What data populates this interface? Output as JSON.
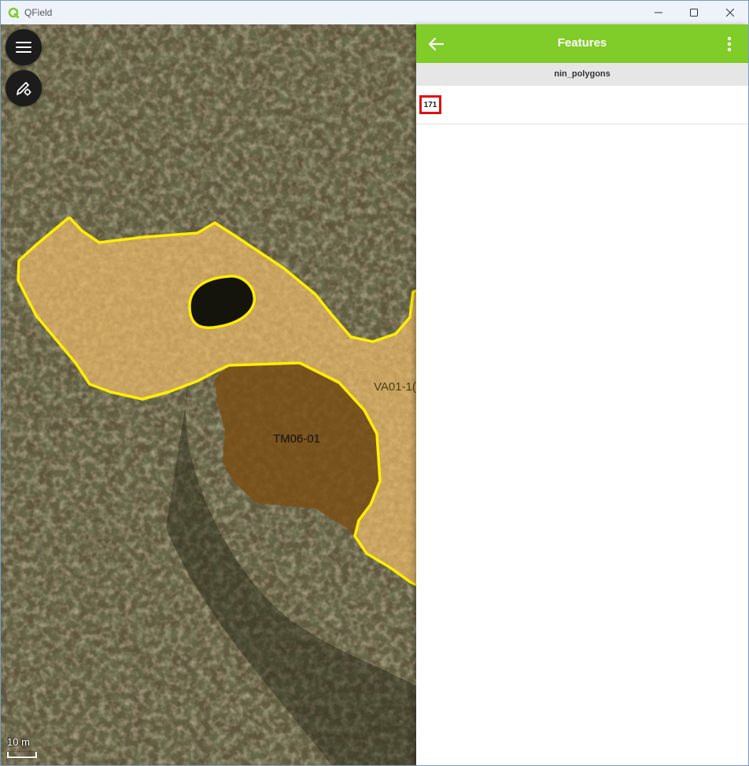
{
  "window": {
    "title": "QField",
    "minimize_icon": "minimize-icon",
    "maximize_icon": "maximize-icon",
    "close_icon": "close-icon"
  },
  "map": {
    "polygon_labels": [
      "TM06-01",
      "VA01-1("
    ],
    "scale_label": "10 m",
    "buttons": {
      "menu_icon": "hamburger-menu-icon",
      "digitize_icon": "digitize-settings-icon"
    },
    "colors": {
      "polygon_outline": "#ffee00",
      "polygon_fill": "#e8b86a",
      "polygon_fill_dark": "#7a4f15"
    }
  },
  "panel": {
    "title": "Features",
    "back_icon": "arrow-left-icon",
    "more_icon": "more-vertical-icon",
    "layer": "nin_polygons",
    "features": [
      {
        "id": "171"
      }
    ],
    "colors": {
      "header": "#80cc28",
      "highlight": "#e01010"
    }
  }
}
